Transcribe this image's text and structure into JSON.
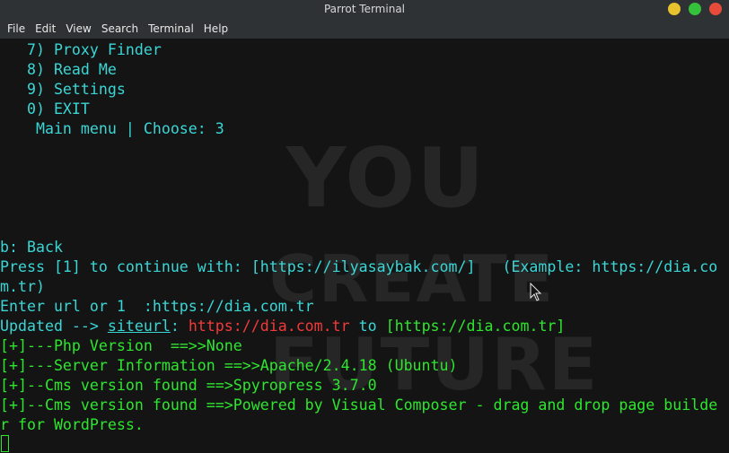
{
  "window": {
    "title": "Parrot Terminal",
    "colors": {
      "minimize": "#e6c22f",
      "maximize": "#34c23b",
      "close": "#e84b3a"
    }
  },
  "menu": [
    "File",
    "Edit",
    "View",
    "Search",
    "Terminal",
    "Help"
  ],
  "watermark": [
    "YOU",
    "CREATE",
    "FUTURE"
  ],
  "terminal": {
    "menu_items": [
      "   7) Proxy Finder",
      "   8) Read Me",
      "   9) Settings",
      "   0) EXIT"
    ],
    "prompt": "    Main menu | Choose: 3",
    "back": "b: Back",
    "press_line_1": "Press [1] to continue with: [https://ilyasaybak.com/]   (Example: https://dia.co",
    "press_line_2": "m.tr)",
    "enter_url": "Enter url or 1  :https://dia.com.tr",
    "updated": {
      "prefix": "Updated --> ",
      "key": "siteurl",
      "colon": ": ",
      "old": "https://dia.com.tr",
      "to": " to ",
      "new": "[https://dia.com.tr]"
    },
    "results": [
      "[+]---Php Version  ==>>None",
      "[+]---Server Information ==>>Apache/2.4.18 (Ubuntu)",
      "[+]--Cms version found ==>Spyropress 3.7.0",
      "[+]--Cms version found ==>Powered by Visual Composer - drag and drop page builde",
      "r for WordPress."
    ],
    "colors": {
      "cyan": "#3ad6d6",
      "green": "#2ee62e",
      "red": "#f23a3a",
      "background": "#141414"
    }
  }
}
